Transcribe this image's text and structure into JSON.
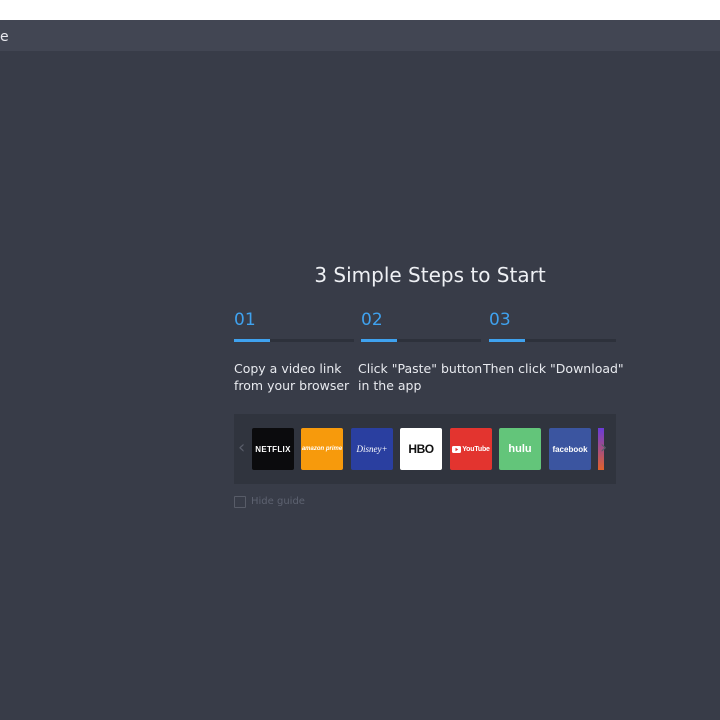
{
  "window": {
    "title_edge": "e"
  },
  "guide": {
    "title": "3 Simple Steps to Start",
    "steps": [
      {
        "number": "01",
        "line1": "Copy a video link",
        "line2": "from your browser"
      },
      {
        "number": "02",
        "line1": "Click \"Paste\" button",
        "line2": "in the app"
      },
      {
        "number": "03",
        "line1": "Then click \"Download\"",
        "line2": ""
      }
    ],
    "accent_color": "#3fa2ef",
    "platforms": [
      {
        "name": "NETFLIX",
        "icon": "netflix-logo",
        "bg": "#0b0b0d",
        "color": "#ffffff"
      },
      {
        "name": "amazon prime",
        "icon": "amazon-prime-logo",
        "bg": "#f79a0c",
        "color": "#ffffff"
      },
      {
        "name": "Disney+",
        "icon": "disney-plus-logo",
        "bg": "#2a3fa0",
        "color": "#ffffff"
      },
      {
        "name": "HBO",
        "icon": "hbo-logo",
        "bg": "#ffffff",
        "color": "#111111"
      },
      {
        "name": "YouTube",
        "icon": "youtube-logo",
        "bg": "#e3342f",
        "color": "#ffffff"
      },
      {
        "name": "hulu",
        "icon": "hulu-logo",
        "bg": "#63c57a",
        "color": "#ffffff"
      },
      {
        "name": "facebook",
        "icon": "facebook-logo",
        "bg": "#3b55a0",
        "color": "#ffffff"
      }
    ],
    "hide_label": "Hide guide"
  }
}
